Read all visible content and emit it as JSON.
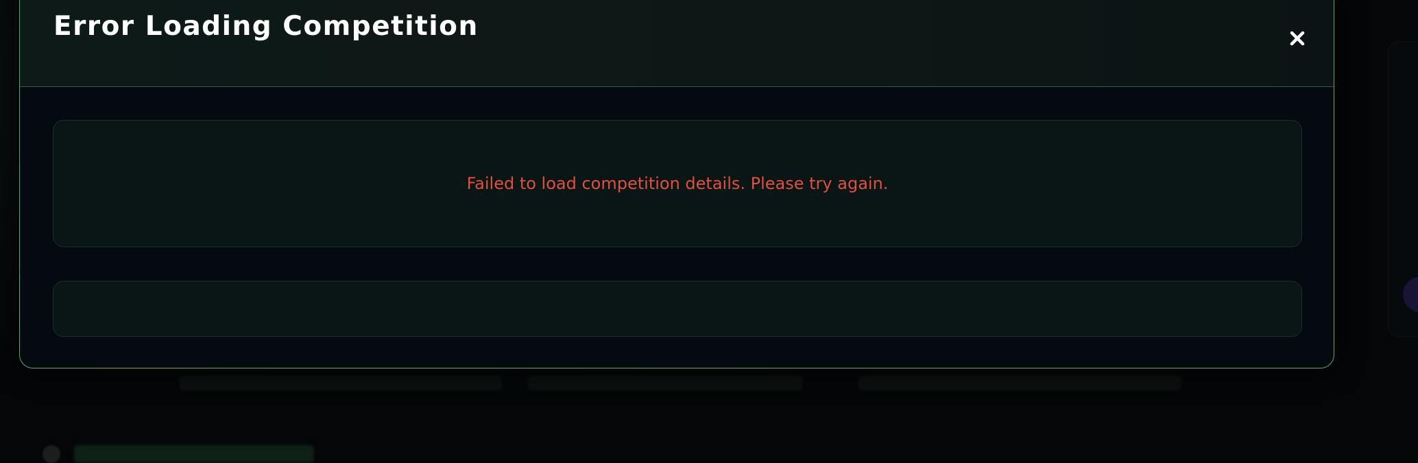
{
  "modal": {
    "title": "Error Loading Competition",
    "close_icon": "close-icon",
    "error_message": "Failed to load competition details. Please try again."
  },
  "colors": {
    "border_accent": "#4caf6e",
    "error_text": "#e0503c",
    "title_text": "#ffffff",
    "modal_background": "#040a10",
    "panel_background": "#0a1515"
  }
}
